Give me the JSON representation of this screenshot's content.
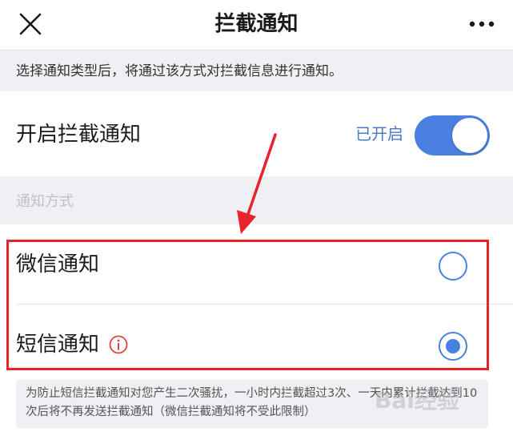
{
  "header": {
    "title": "拦截通知"
  },
  "description": "选择通知类型后，将通过该方式对拦截信息进行通知。",
  "enable": {
    "label": "开启拦截通知",
    "status": "已开启",
    "enabled": true
  },
  "section": {
    "label": "通知方式"
  },
  "options": [
    {
      "label": "微信通知",
      "selected": false
    },
    {
      "label": "短信通知",
      "selected": true,
      "has_info_icon": true
    }
  ],
  "footer": {
    "note": "为防止短信拦截通知对您产生二次骚扰，一小时内拦截超过3次、一天内累计拦截达到10次后将不再发送拦截通知（微信拦截通知将不受此限制）"
  },
  "watermark": "Bai经验",
  "colors": {
    "accent": "#4a80e0",
    "highlight": "#e8242a",
    "background_gray": "#efeff4"
  },
  "icons": [
    "close-icon",
    "more-icon",
    "info-icon",
    "arrow-icon"
  ]
}
